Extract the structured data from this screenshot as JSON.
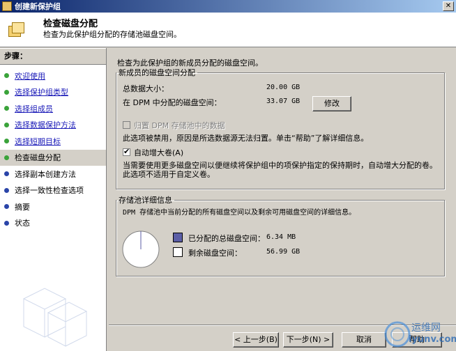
{
  "window": {
    "title": "创建新保护组",
    "close_glyph": "✕"
  },
  "header": {
    "title": "检查磁盘分配",
    "subtitle": "检查为此保护组分配的存储池磁盘空间。"
  },
  "steps": {
    "title": "步骤：",
    "items": [
      {
        "label": "欢迎使用",
        "state": "done"
      },
      {
        "label": "选择保护组类型",
        "state": "done"
      },
      {
        "label": "选择组成员",
        "state": "done"
      },
      {
        "label": "选择数据保护方法",
        "state": "done"
      },
      {
        "label": "选择短期目标",
        "state": "done"
      },
      {
        "label": "检查磁盘分配",
        "state": "current"
      },
      {
        "label": "选择副本创建方法",
        "state": "pending"
      },
      {
        "label": "选择一致性检查选项",
        "state": "pending"
      },
      {
        "label": "摘要",
        "state": "pending"
      },
      {
        "label": "状态",
        "state": "pending"
      }
    ]
  },
  "main": {
    "intro": "检查为此保护组的新成员分配的磁盘空间。",
    "new_members": {
      "legend": "新成员的磁盘空间分配",
      "total_label": "总数据大小：",
      "total_value": "20.00 GB",
      "allocated_label": "在 DPM 中分配的磁盘空间：",
      "allocated_value": "33.07 GB",
      "modify_button": "修改",
      "colocate_label": "归置 DPM 存储池中的数据",
      "colocate_note": "此选项被禁用，原因是所选数据源无法归置。单击“帮助”了解详细信息。",
      "autogrow_label": "自动增大卷(A)",
      "autogrow_checked": true,
      "autogrow_desc_1": "当需要使用更多磁盘空间以便继续将保护组中的项保护指定的保持期时，自动增大分配的卷。",
      "autogrow_desc_2": "此选项不适用于自定义卷。"
    },
    "storage_pool": {
      "legend": "存储池详细信息",
      "desc": "DPM 存储池中当前分配的所有磁盘空间以及剩余可用磁盘空间的详细信息。",
      "allocated_label": "已分配的总磁盘空间：",
      "allocated_value": "6.34 MB",
      "free_label": "剩余磁盘空间：",
      "free_value": "56.99 GB",
      "allocated_color": "#5b5ea6",
      "free_color": "#ffffff"
    }
  },
  "footer": {
    "back_button": "< 上一步(B)",
    "next_button": "下一步(N) >",
    "cancel_button": "取消",
    "help_button": "帮助"
  },
  "watermark": {
    "text": "运维网",
    "url": "iyunv.com"
  },
  "colors": {
    "link": "#1a1ab8",
    "done_dot": "#3aa33a",
    "pending_dot": "#2a44a8"
  }
}
